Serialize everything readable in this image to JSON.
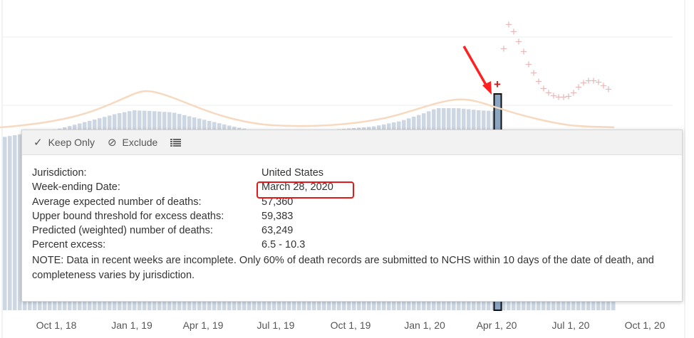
{
  "chart_data": {
    "type": "bar",
    "x_ticks": [
      "Oct 1, 18",
      "Jan 1, 19",
      "Apr 1, 19",
      "Jul 1, 19",
      "Oct 1, 19",
      "Jan 1, 20",
      "Apr 1, 20",
      "Jul 1, 20",
      "Oct 1, 20"
    ],
    "selected_week": "March 28, 2020",
    "marker_symbol": "+",
    "colors": {
      "bars": "#cdd7e3",
      "selected_bar": "#8aa6c3",
      "threshold_line": "#f6d9bf",
      "excess_marker": "#e7b8b8",
      "selected_marker": "#c81d1d",
      "annotation_arrow": "#ff2020",
      "grid": "#ececec"
    }
  },
  "tooltip": {
    "actions": {
      "keep_only": "Keep Only",
      "exclude": "Exclude",
      "keep_icon": "checkmark-icon",
      "exclude_icon": "no-entry-icon",
      "view_data_icon": "view-data-icon"
    },
    "rows": [
      {
        "label": "Jurisdiction:",
        "value": "United States"
      },
      {
        "label": "Week-ending Date:",
        "value": "March 28, 2020"
      },
      {
        "label": "Average expected number of deaths:",
        "value": "57,360"
      },
      {
        "label": "Upper bound threshold for excess deaths:",
        "value": "59,383"
      },
      {
        "label": "Predicted (weighted) number of deaths:",
        "value": "63,249"
      },
      {
        "label": "Percent excess:",
        "value": "6.5 - 10.3"
      }
    ],
    "note": "NOTE: Data in recent weeks are incomplete. Only 60% of death records are submitted to NCHS within 10 days of the date of death, and completeness varies by jurisdiction."
  }
}
